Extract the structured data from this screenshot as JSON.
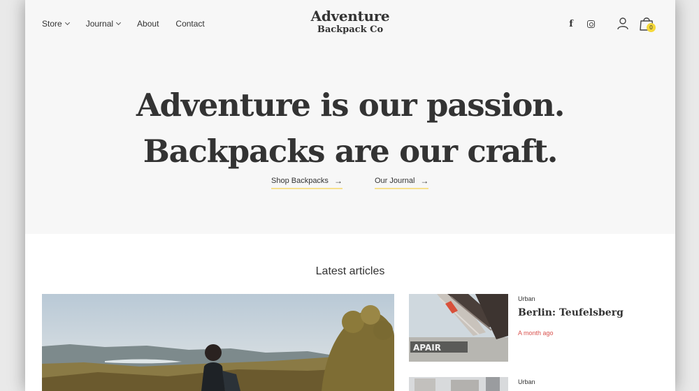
{
  "header": {
    "nav": [
      {
        "label": "Store",
        "dropdown": true
      },
      {
        "label": "Journal",
        "dropdown": true
      },
      {
        "label": "About",
        "dropdown": false
      },
      {
        "label": "Contact",
        "dropdown": false
      }
    ],
    "logo": {
      "line1": "Adventure",
      "line2": "Backpack Co"
    },
    "social": {
      "facebook_glyph": "f",
      "icons": [
        "facebook-icon",
        "instagram-icon"
      ]
    },
    "cart_count": "0",
    "accent_color": "#f5d83a"
  },
  "hero": {
    "line1": "Adventure is our passion.",
    "line2": "Backpacks are our craft.",
    "links": [
      {
        "label": "Shop Backpacks",
        "arrow": "→"
      },
      {
        "label": "Our Journal",
        "arrow": "→"
      }
    ]
  },
  "articles": {
    "heading": "Latest articles",
    "cards": [
      {
        "category": "Urban",
        "title": "Berlin: Teufelsberg",
        "date": "A month ago"
      },
      {
        "category": "Urban"
      }
    ]
  }
}
